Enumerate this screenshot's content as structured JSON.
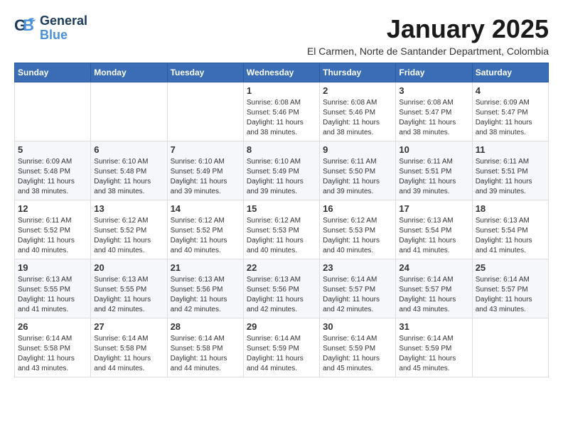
{
  "app": {
    "logo_line1": "General",
    "logo_line2": "Blue",
    "month": "January 2025",
    "location": "El Carmen, Norte de Santander Department, Colombia"
  },
  "weekdays": [
    "Sunday",
    "Monday",
    "Tuesday",
    "Wednesday",
    "Thursday",
    "Friday",
    "Saturday"
  ],
  "weeks": [
    [
      {
        "day": "",
        "info": ""
      },
      {
        "day": "",
        "info": ""
      },
      {
        "day": "",
        "info": ""
      },
      {
        "day": "1",
        "info": "Sunrise: 6:08 AM\nSunset: 5:46 PM\nDaylight: 11 hours and 38 minutes."
      },
      {
        "day": "2",
        "info": "Sunrise: 6:08 AM\nSunset: 5:46 PM\nDaylight: 11 hours and 38 minutes."
      },
      {
        "day": "3",
        "info": "Sunrise: 6:08 AM\nSunset: 5:47 PM\nDaylight: 11 hours and 38 minutes."
      },
      {
        "day": "4",
        "info": "Sunrise: 6:09 AM\nSunset: 5:47 PM\nDaylight: 11 hours and 38 minutes."
      }
    ],
    [
      {
        "day": "5",
        "info": "Sunrise: 6:09 AM\nSunset: 5:48 PM\nDaylight: 11 hours and 38 minutes."
      },
      {
        "day": "6",
        "info": "Sunrise: 6:10 AM\nSunset: 5:48 PM\nDaylight: 11 hours and 38 minutes."
      },
      {
        "day": "7",
        "info": "Sunrise: 6:10 AM\nSunset: 5:49 PM\nDaylight: 11 hours and 39 minutes."
      },
      {
        "day": "8",
        "info": "Sunrise: 6:10 AM\nSunset: 5:49 PM\nDaylight: 11 hours and 39 minutes."
      },
      {
        "day": "9",
        "info": "Sunrise: 6:11 AM\nSunset: 5:50 PM\nDaylight: 11 hours and 39 minutes."
      },
      {
        "day": "10",
        "info": "Sunrise: 6:11 AM\nSunset: 5:51 PM\nDaylight: 11 hours and 39 minutes."
      },
      {
        "day": "11",
        "info": "Sunrise: 6:11 AM\nSunset: 5:51 PM\nDaylight: 11 hours and 39 minutes."
      }
    ],
    [
      {
        "day": "12",
        "info": "Sunrise: 6:11 AM\nSunset: 5:52 PM\nDaylight: 11 hours and 40 minutes."
      },
      {
        "day": "13",
        "info": "Sunrise: 6:12 AM\nSunset: 5:52 PM\nDaylight: 11 hours and 40 minutes."
      },
      {
        "day": "14",
        "info": "Sunrise: 6:12 AM\nSunset: 5:52 PM\nDaylight: 11 hours and 40 minutes."
      },
      {
        "day": "15",
        "info": "Sunrise: 6:12 AM\nSunset: 5:53 PM\nDaylight: 11 hours and 40 minutes."
      },
      {
        "day": "16",
        "info": "Sunrise: 6:12 AM\nSunset: 5:53 PM\nDaylight: 11 hours and 40 minutes."
      },
      {
        "day": "17",
        "info": "Sunrise: 6:13 AM\nSunset: 5:54 PM\nDaylight: 11 hours and 41 minutes."
      },
      {
        "day": "18",
        "info": "Sunrise: 6:13 AM\nSunset: 5:54 PM\nDaylight: 11 hours and 41 minutes."
      }
    ],
    [
      {
        "day": "19",
        "info": "Sunrise: 6:13 AM\nSunset: 5:55 PM\nDaylight: 11 hours and 41 minutes."
      },
      {
        "day": "20",
        "info": "Sunrise: 6:13 AM\nSunset: 5:55 PM\nDaylight: 11 hours and 42 minutes."
      },
      {
        "day": "21",
        "info": "Sunrise: 6:13 AM\nSunset: 5:56 PM\nDaylight: 11 hours and 42 minutes."
      },
      {
        "day": "22",
        "info": "Sunrise: 6:13 AM\nSunset: 5:56 PM\nDaylight: 11 hours and 42 minutes."
      },
      {
        "day": "23",
        "info": "Sunrise: 6:14 AM\nSunset: 5:57 PM\nDaylight: 11 hours and 42 minutes."
      },
      {
        "day": "24",
        "info": "Sunrise: 6:14 AM\nSunset: 5:57 PM\nDaylight: 11 hours and 43 minutes."
      },
      {
        "day": "25",
        "info": "Sunrise: 6:14 AM\nSunset: 5:57 PM\nDaylight: 11 hours and 43 minutes."
      }
    ],
    [
      {
        "day": "26",
        "info": "Sunrise: 6:14 AM\nSunset: 5:58 PM\nDaylight: 11 hours and 43 minutes."
      },
      {
        "day": "27",
        "info": "Sunrise: 6:14 AM\nSunset: 5:58 PM\nDaylight: 11 hours and 44 minutes."
      },
      {
        "day": "28",
        "info": "Sunrise: 6:14 AM\nSunset: 5:58 PM\nDaylight: 11 hours and 44 minutes."
      },
      {
        "day": "29",
        "info": "Sunrise: 6:14 AM\nSunset: 5:59 PM\nDaylight: 11 hours and 44 minutes."
      },
      {
        "day": "30",
        "info": "Sunrise: 6:14 AM\nSunset: 5:59 PM\nDaylight: 11 hours and 45 minutes."
      },
      {
        "day": "31",
        "info": "Sunrise: 6:14 AM\nSunset: 5:59 PM\nDaylight: 11 hours and 45 minutes."
      },
      {
        "day": "",
        "info": ""
      }
    ]
  ]
}
